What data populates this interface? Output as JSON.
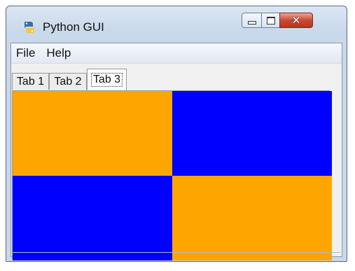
{
  "window": {
    "title": "Python GUI",
    "controls": {
      "minimize": "minimize",
      "maximize": "maximize",
      "close": "✕"
    }
  },
  "menu": {
    "items": [
      {
        "label": "File"
      },
      {
        "label": "Help"
      }
    ]
  },
  "tabs": [
    {
      "label": "Tab 1",
      "selected": false
    },
    {
      "label": "Tab 2",
      "selected": false
    },
    {
      "label": "Tab 3",
      "selected": true
    }
  ],
  "canvas": {
    "cells": [
      {
        "position": "top-left",
        "color": "#FFA500"
      },
      {
        "position": "top-right",
        "color": "#0000FF"
      },
      {
        "position": "bottom-left",
        "color": "#0000FF"
      },
      {
        "position": "bottom-right",
        "color": "#FFA500"
      }
    ]
  }
}
